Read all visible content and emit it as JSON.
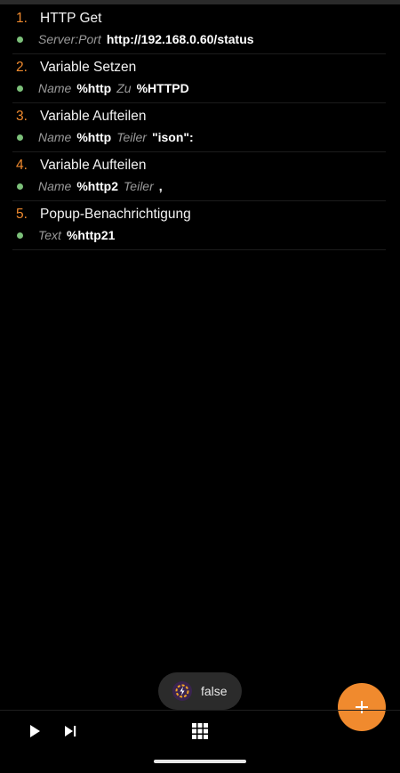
{
  "actions": [
    {
      "number": "1.",
      "title": "HTTP Get",
      "params": [
        {
          "name": "Server:Port",
          "value": "http://192.168.0.60/status"
        }
      ]
    },
    {
      "number": "2.",
      "title": "Variable Setzen",
      "params": [
        {
          "name": "Name",
          "value": "%http"
        },
        {
          "name": "Zu",
          "value": "%HTTPD"
        }
      ]
    },
    {
      "number": "3.",
      "title": "Variable Aufteilen",
      "params": [
        {
          "name": "Name",
          "value": "%http"
        },
        {
          "name": "Teiler",
          "value": "\"ison\":"
        }
      ]
    },
    {
      "number": "4.",
      "title": "Variable Aufteilen",
      "params": [
        {
          "name": "Name",
          "value": "%http2"
        },
        {
          "name": "Teiler",
          "value": ","
        }
      ]
    },
    {
      "number": "5.",
      "title": "Popup-Benachrichtigung",
      "params": [
        {
          "name": "Text",
          "value": "%http21"
        }
      ]
    }
  ],
  "toast": {
    "text": "false",
    "icon": "tasker-app-icon"
  },
  "fab": {
    "icon": "plus-icon"
  },
  "bottom_bar": {
    "play_icon": "play-icon",
    "step_icon": "skip-next-icon",
    "grid_icon": "grid-icon"
  },
  "colors": {
    "accent": "#f08a2e",
    "bullet": "#7cc07a",
    "background": "#000000"
  }
}
